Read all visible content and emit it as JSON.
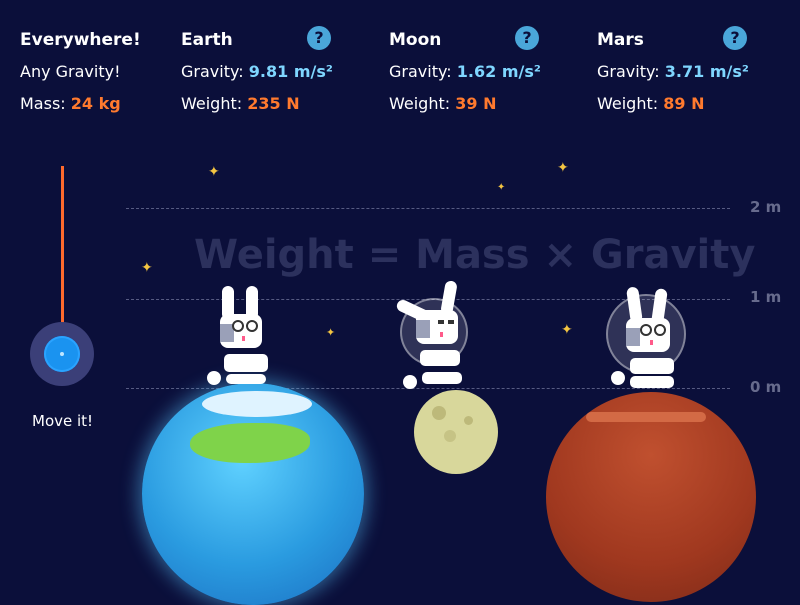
{
  "everywhere": {
    "title": "Everywhere!",
    "subtitle": "Any Gravity!",
    "mass_label": "Mass:",
    "mass_value": "24 kg"
  },
  "planets": [
    {
      "name": "Earth",
      "gravity_label": "Gravity:",
      "gravity_value": "9.81 m/s²",
      "weight_label": "Weight:",
      "weight_value": "235 N"
    },
    {
      "name": "Moon",
      "gravity_label": "Gravity:",
      "gravity_value": "1.62  m/s²",
      "weight_label": "Weight:",
      "weight_value": "39 N"
    },
    {
      "name": "Mars",
      "gravity_label": "Gravity:",
      "gravity_value": "3.71 m/s²",
      "weight_label": "Weight:",
      "weight_value": "89 N"
    }
  ],
  "help_glyph": "?",
  "formula": "Weight = Mass × Gravity",
  "grid_labels": [
    "2 m",
    "1 m",
    "0 m"
  ],
  "slider": {
    "label": "Move it!"
  },
  "colors": {
    "background": "#0b0f3a",
    "accent": "#ff7a2e",
    "gravity": "#7fd6ff",
    "knob": "#1a93f0"
  },
  "icons": [
    "help-icon",
    "star-icon",
    "bunny-icon",
    "earth-icon",
    "moon-icon",
    "mars-icon"
  ]
}
